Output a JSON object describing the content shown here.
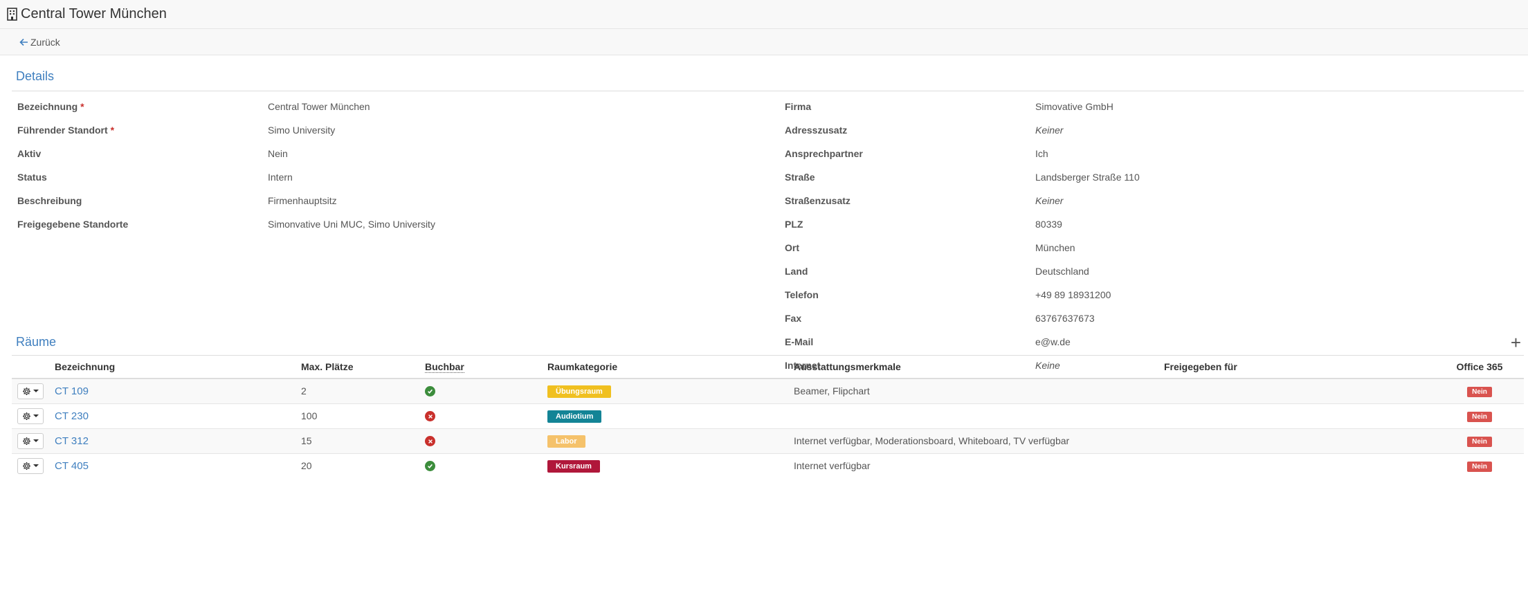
{
  "header": {
    "title": "Central Tower München",
    "icon": "building-icon"
  },
  "toolbar": {
    "back_label": "Zurück"
  },
  "details": {
    "section_title": "Details",
    "left": [
      {
        "label": "Bezeichnung",
        "required": "*",
        "value": "Central Tower München",
        "italic": false
      },
      {
        "label": "Führender Standort",
        "required": "*",
        "value": "Simo University",
        "italic": false
      },
      {
        "label": "Aktiv",
        "required": "",
        "value": "Nein",
        "italic": false
      },
      {
        "label": "Status",
        "required": "",
        "value": "Intern",
        "italic": false
      },
      {
        "label": "Beschreibung",
        "required": "",
        "value": "Firmenhauptsitz",
        "italic": false
      },
      {
        "label": "Freigegebene Standorte",
        "required": "",
        "value": "Simonvative Uni MUC, Simo University",
        "italic": false
      }
    ],
    "right": [
      {
        "label": "Firma",
        "value": "Simovative GmbH",
        "italic": false
      },
      {
        "label": "Adresszusatz",
        "value": "Keiner",
        "italic": true
      },
      {
        "label": "Ansprechpartner",
        "value": "Ich",
        "italic": false
      },
      {
        "label": "Straße",
        "value": "Landsberger Straße 110",
        "italic": false
      },
      {
        "label": "Straßenzusatz",
        "value": "Keiner",
        "italic": true
      },
      {
        "label": "PLZ",
        "value": "80339",
        "italic": false
      },
      {
        "label": "Ort",
        "value": "München",
        "italic": false
      },
      {
        "label": "Land",
        "value": "Deutschland",
        "italic": false
      },
      {
        "label": "Telefon",
        "value": "+49 89 18931200",
        "italic": false
      },
      {
        "label": "Fax",
        "value": "63767637673",
        "italic": false
      },
      {
        "label": "E-Mail",
        "value": "e@w.de",
        "italic": false
      },
      {
        "label": "Internet",
        "value": "Keine",
        "italic": true
      }
    ]
  },
  "rooms": {
    "section_title": "Räume",
    "add_label": "+",
    "columns": {
      "name": "Bezeichnung",
      "seats": "Max. Plätze",
      "bookable": "Buchbar",
      "category": "Raumkategorie",
      "features": "Ausstattungsmerkmale",
      "shared": "Freigegeben für",
      "office": "Office 365"
    },
    "rows": [
      {
        "name": "CT 109",
        "seats": "2",
        "bookable": true,
        "category": "Übungsraum",
        "category_color": "#f0c020",
        "features": "Beamer, Flipchart",
        "shared": "",
        "office": "Nein"
      },
      {
        "name": "CT 230",
        "seats": "100",
        "bookable": false,
        "category": "Audiotium",
        "category_color": "#138496",
        "features": "",
        "shared": "",
        "office": "Nein"
      },
      {
        "name": "CT 312",
        "seats": "15",
        "bookable": false,
        "category": "Labor",
        "category_color": "#f5c26b",
        "features": "Internet verfügbar, Moderationsboard, Whiteboard, TV verfügbar",
        "shared": "",
        "office": "Nein"
      },
      {
        "name": "CT 405",
        "seats": "20",
        "bookable": true,
        "category": "Kursraum",
        "category_color": "#b0173a",
        "features": "Internet verfügbar",
        "shared": "",
        "office": "Nein"
      }
    ]
  },
  "colors": {
    "link": "#3f7fbf",
    "yes": "#3c8d3c",
    "no": "#c9302c",
    "nein_badge": "#d9534f"
  }
}
